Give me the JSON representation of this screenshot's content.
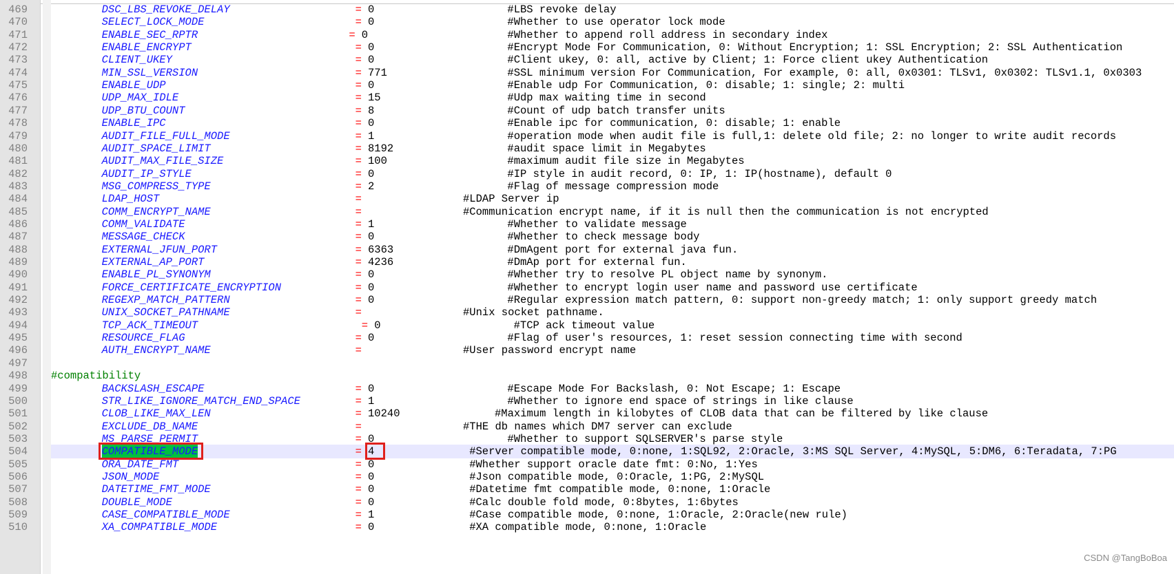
{
  "editor": {
    "lines": [
      {
        "num": "469",
        "key": "DSC_LBS_REVOKE_DELAY",
        "eq": "=",
        "eqc": 48,
        "val": "0",
        "cmt": "#LBS revoke delay",
        "cc": 72
      },
      {
        "num": "470",
        "key": "SELECT_LOCK_MODE",
        "eq": "=",
        "eqc": 48,
        "val": "0",
        "cmt": "#Whether to use operator lock mode",
        "cc": 72
      },
      {
        "num": "471",
        "key": "ENABLE_SEC_RPTR",
        "eq": "=",
        "eqc": 47,
        "val": "0",
        "cmt": "#Whether to append roll address in secondary index",
        "cc": 72
      },
      {
        "num": "472",
        "key": "ENABLE_ENCRYPT",
        "eq": "=",
        "eqc": 48,
        "val": "0",
        "cmt": "#Encrypt Mode For Communication, 0: Without Encryption; 1: SSL Encryption; 2: SSL Authentication",
        "cc": 72
      },
      {
        "num": "473",
        "key": "CLIENT_UKEY",
        "eq": "=",
        "eqc": 48,
        "val": "0",
        "cmt": "#Client ukey, 0: all, active by Client; 1: Force client ukey Authentication",
        "cc": 72
      },
      {
        "num": "474",
        "key": "MIN_SSL_VERSION",
        "eq": "=",
        "eqc": 48,
        "val": "771",
        "cmt": "#SSL minimum version For Communication, For example, 0: all, 0x0301: TLSv1, 0x0302: TLSv1.1, 0x0303",
        "cc": 72
      },
      {
        "num": "475",
        "key": "ENABLE_UDP",
        "eq": "=",
        "eqc": 48,
        "val": "0",
        "cmt": "#Enable udp For Communication, 0: disable; 1: single; 2: multi",
        "cc": 72
      },
      {
        "num": "476",
        "key": "UDP_MAX_IDLE",
        "eq": "=",
        "eqc": 48,
        "val": "15",
        "cmt": "#Udp max waiting time in second",
        "cc": 72
      },
      {
        "num": "477",
        "key": "UDP_BTU_COUNT",
        "eq": "=",
        "eqc": 48,
        "val": "8",
        "cmt": "#Count of udp batch transfer units",
        "cc": 72
      },
      {
        "num": "478",
        "key": "ENABLE_IPC",
        "eq": "=",
        "eqc": 48,
        "val": "0",
        "cmt": "#Enable ipc for communication, 0: disable; 1: enable",
        "cc": 72
      },
      {
        "num": "479",
        "key": "AUDIT_FILE_FULL_MODE",
        "eq": "=",
        "eqc": 48,
        "val": "1",
        "cmt": "#operation mode when audit file is full,1: delete old file; 2: no longer to write audit records",
        "cc": 72
      },
      {
        "num": "480",
        "key": "AUDIT_SPACE_LIMIT",
        "eq": "=",
        "eqc": 48,
        "val": "8192",
        "cmt": "#audit space limit in Megabytes",
        "cc": 72
      },
      {
        "num": "481",
        "key": "AUDIT_MAX_FILE_SIZE",
        "eq": "=",
        "eqc": 48,
        "val": "100",
        "cmt": "#maximum audit file size in Megabytes",
        "cc": 72
      },
      {
        "num": "482",
        "key": "AUDIT_IP_STYLE",
        "eq": "=",
        "eqc": 48,
        "val": "0",
        "cmt": "#IP style in audit record, 0: IP, 1: IP(hostname), default 0",
        "cc": 72
      },
      {
        "num": "483",
        "key": "MSG_COMPRESS_TYPE",
        "eq": "=",
        "eqc": 48,
        "val": "2",
        "cmt": "#Flag of message compression mode",
        "cc": 72
      },
      {
        "num": "484",
        "key": "LDAP_HOST",
        "eq": "=",
        "eqc": 48,
        "val": "",
        "cmt": "#LDAP Server ip",
        "cc": 65
      },
      {
        "num": "485",
        "key": "COMM_ENCRYPT_NAME",
        "eq": "=",
        "eqc": 48,
        "val": "",
        "cmt": "#Communication encrypt name, if it is null then the communication is not encrypted",
        "cc": 65
      },
      {
        "num": "486",
        "key": "COMM_VALIDATE",
        "eq": "=",
        "eqc": 48,
        "val": "1",
        "cmt": "#Whether to validate message",
        "cc": 72
      },
      {
        "num": "487",
        "key": "MESSAGE_CHECK",
        "eq": "=",
        "eqc": 48,
        "val": "0",
        "cmt": "#Whether to check message body",
        "cc": 72
      },
      {
        "num": "488",
        "key": "EXTERNAL_JFUN_PORT",
        "eq": "=",
        "eqc": 48,
        "val": "6363",
        "cmt": "#DmAgent port for external java fun.",
        "cc": 72
      },
      {
        "num": "489",
        "key": "EXTERNAL_AP_PORT",
        "eq": "=",
        "eqc": 48,
        "val": "4236",
        "cmt": "#DmAp port for external fun.",
        "cc": 72
      },
      {
        "num": "490",
        "key": "ENABLE_PL_SYNONYM",
        "eq": "=",
        "eqc": 48,
        "val": "0",
        "cmt": "#Whether try to resolve PL object name by synonym.",
        "cc": 72
      },
      {
        "num": "491",
        "key": "FORCE_CERTIFICATE_ENCRYPTION",
        "eq": "=",
        "eqc": 48,
        "val": "0",
        "cmt": "#Whether to encrypt login user name and password use certificate",
        "cc": 72
      },
      {
        "num": "492",
        "key": "REGEXP_MATCH_PATTERN",
        "eq": "=",
        "eqc": 48,
        "val": "0",
        "cmt": "#Regular expression match pattern, 0: support non-greedy match; 1: only support greedy match",
        "cc": 72
      },
      {
        "num": "493",
        "key": "UNIX_SOCKET_PATHNAME",
        "eq": "=",
        "eqc": 48,
        "val": "",
        "cmt": "#Unix socket pathname.",
        "cc": 65
      },
      {
        "num": "494",
        "key": "TCP_ACK_TIMEOUT",
        "eq": "=",
        "eqc": 49,
        "val": "0",
        "cmt": "#TCP ack timeout value",
        "cc": 73
      },
      {
        "num": "495",
        "key": "RESOURCE_FLAG",
        "eq": "=",
        "eqc": 48,
        "val": "0",
        "cmt": "#Flag of user's resources, 1: reset session connecting time with second",
        "cc": 72
      },
      {
        "num": "496",
        "key": "AUTH_ENCRYPT_NAME",
        "eq": "=",
        "eqc": 48,
        "val": "",
        "cmt": "#User password encrypt name",
        "cc": 65
      },
      {
        "num": "497",
        "blank": true
      },
      {
        "num": "498",
        "section": "#compatibility"
      },
      {
        "num": "499",
        "key": "BACKSLASH_ESCAPE",
        "eq": "=",
        "eqc": 48,
        "val": "0",
        "cmt": "#Escape Mode For Backslash, 0: Not Escape; 1: Escape",
        "cc": 72
      },
      {
        "num": "500",
        "key": "STR_LIKE_IGNORE_MATCH_END_SPACE",
        "eq": "=",
        "eqc": 48,
        "val": "1",
        "cmt": "#Whether to ignore end space of strings in like clause",
        "cc": 72
      },
      {
        "num": "501",
        "key": "CLOB_LIKE_MAX_LEN",
        "eq": "=",
        "eqc": 48,
        "val": "10240",
        "cmt": "#Maximum length in kilobytes of CLOB data that can be filtered by like clause",
        "cc": 70
      },
      {
        "num": "502",
        "key": "EXCLUDE_DB_NAME",
        "eq": "=",
        "eqc": 48,
        "val": "",
        "cmt": "#THE db names which DM7 server can exclude",
        "cc": 65
      },
      {
        "num": "503",
        "key": "MS_PARSE_PERMIT",
        "eq": "=",
        "eqc": 48,
        "val": "0",
        "cmt": "#Whether to support SQLSERVER's parse style",
        "cc": 72
      },
      {
        "num": "504",
        "key": "COMPATIBLE_MODE",
        "eq": "=",
        "eqc": 48,
        "val": "4",
        "cmt": "#Server compatible mode, 0:none, 1:SQL92, 2:Oracle, 3:MS SQL Server, 4:MySQL, 5:DM6, 6:Teradata, 7:PG",
        "cc": 66,
        "current": true
      },
      {
        "num": "505",
        "key": "ORA_DATE_FMT",
        "eq": "=",
        "eqc": 48,
        "val": "0",
        "cmt": "#Whether support oracle date fmt: 0:No, 1:Yes",
        "cc": 66
      },
      {
        "num": "506",
        "key": "JSON_MODE",
        "eq": "=",
        "eqc": 48,
        "val": "0",
        "cmt": "#Json compatible mode, 0:Oracle, 1:PG, 2:MySQL",
        "cc": 66
      },
      {
        "num": "507",
        "key": "DATETIME_FMT_MODE",
        "eq": "=",
        "eqc": 48,
        "val": "0",
        "cmt": "#Datetime fmt compatible mode, 0:none, 1:Oracle",
        "cc": 66
      },
      {
        "num": "508",
        "key": "DOUBLE_MODE",
        "eq": "=",
        "eqc": 48,
        "val": "0",
        "cmt": "#Calc double fold mode, 0:8bytes, 1:6bytes",
        "cc": 66
      },
      {
        "num": "509",
        "key": "CASE_COMPATIBLE_MODE",
        "eq": "=",
        "eqc": 48,
        "val": "1",
        "cmt": "#Case compatible mode, 0:none, 1:Oracle, 2:Oracle(new rule)",
        "cc": 66
      },
      {
        "num": "510",
        "key": "XA_COMPATIBLE_MODE",
        "eq": "=",
        "eqc": 48,
        "val": "0",
        "cmt": "#XA compatible mode, 0:none, 1:Oracle",
        "cc": 66
      }
    ]
  },
  "watermark": "CSDN @TangBoBoa",
  "colors": {
    "key": "#1a1aff",
    "equals": "#ff0000",
    "section": "#008000",
    "selection": "#00c040",
    "highlight_box": "#e0201c",
    "current_line": "#e8e8ff"
  }
}
